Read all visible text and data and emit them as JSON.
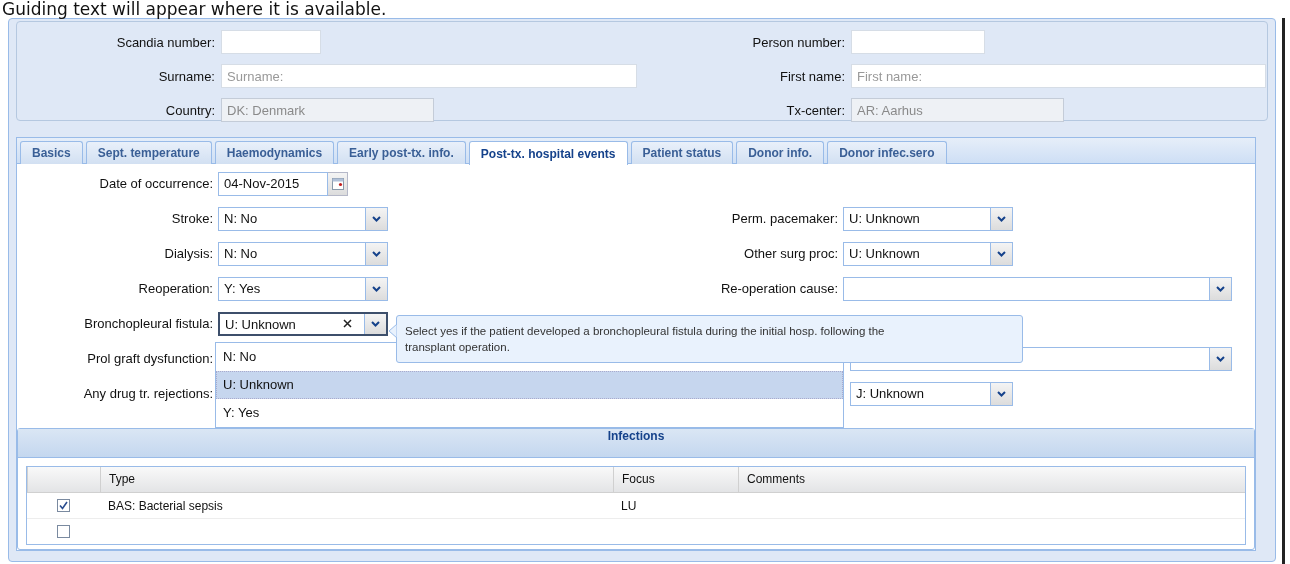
{
  "guide_text": "Guiding text will appear where it is available.",
  "header": {
    "left": [
      {
        "label": "Scandia number:",
        "disabled": false
      },
      {
        "label": "Surname:",
        "placeholder": "Surname:",
        "disabled": false
      },
      {
        "label": "Country:",
        "value": "DK: Denmark",
        "disabled": true
      }
    ],
    "right": [
      {
        "label": "Person number:",
        "disabled": false
      },
      {
        "label": "First name:",
        "placeholder": "First name:",
        "disabled": false
      },
      {
        "label": "Tx-center:",
        "value": "AR: Aarhus",
        "disabled": true
      }
    ]
  },
  "tabs": [
    {
      "label": "Basics",
      "selected": false
    },
    {
      "label": "Sept. temperature",
      "selected": false
    },
    {
      "label": "Haemodynamics",
      "selected": false
    },
    {
      "label": "Early post-tx. info.",
      "selected": false
    },
    {
      "label": "Post-tx. hospital events",
      "selected": true
    },
    {
      "label": "Patient status",
      "selected": false
    },
    {
      "label": "Donor info.",
      "selected": false
    },
    {
      "label": "Donor infec.sero",
      "selected": false
    }
  ],
  "form_rows": [
    {
      "left": {
        "label": "Date of occurrence:",
        "kind": "date",
        "value": "04-Nov-2015"
      }
    },
    {
      "left": {
        "label": "Stroke:",
        "kind": "combo",
        "value": "N: No"
      },
      "right": {
        "label": "Perm. pacemaker:",
        "kind": "combo",
        "value": "U: Unknown"
      }
    },
    {
      "left": {
        "label": "Dialysis:",
        "kind": "combo",
        "value": "N: No"
      },
      "right": {
        "label": "Other surg proc:",
        "kind": "combo",
        "value": "U: Unknown"
      }
    },
    {
      "left": {
        "label": "Reoperation:",
        "kind": "combo",
        "value": "Y: Yes"
      },
      "right": {
        "label": "Re-operation cause:",
        "kind": "long-combo"
      }
    },
    {
      "left": {
        "label": "Bronchopleural fistula:",
        "kind": "active-combo",
        "value": "U: Unknown"
      }
    },
    {
      "left": {
        "label": "Prol graft dysfunction:",
        "kind": "covered"
      },
      "right": {
        "kind": "covered-long-combo"
      }
    },
    {
      "left": {
        "label": "Any drug tr. rejections:",
        "kind": "covered"
      },
      "right": {
        "kind": "covered-combo",
        "value": "J: Unknown"
      }
    }
  ],
  "tooltip": "Select yes if the patient developed a bronchopleural fistula during the initial hosp. following the transplant operation.",
  "dropdown_options": [
    {
      "label": "N: No",
      "selected": false
    },
    {
      "label": "U: Unknown",
      "selected": true
    },
    {
      "label": "Y: Yes",
      "selected": false
    }
  ],
  "infections": {
    "title": "Infections",
    "columns": [
      "Type",
      "Focus",
      "Comments"
    ],
    "rows": [
      {
        "checked": true,
        "type": "BAS: Bacterial sepsis",
        "focus": "LU"
      },
      {
        "checked": false
      }
    ]
  }
}
